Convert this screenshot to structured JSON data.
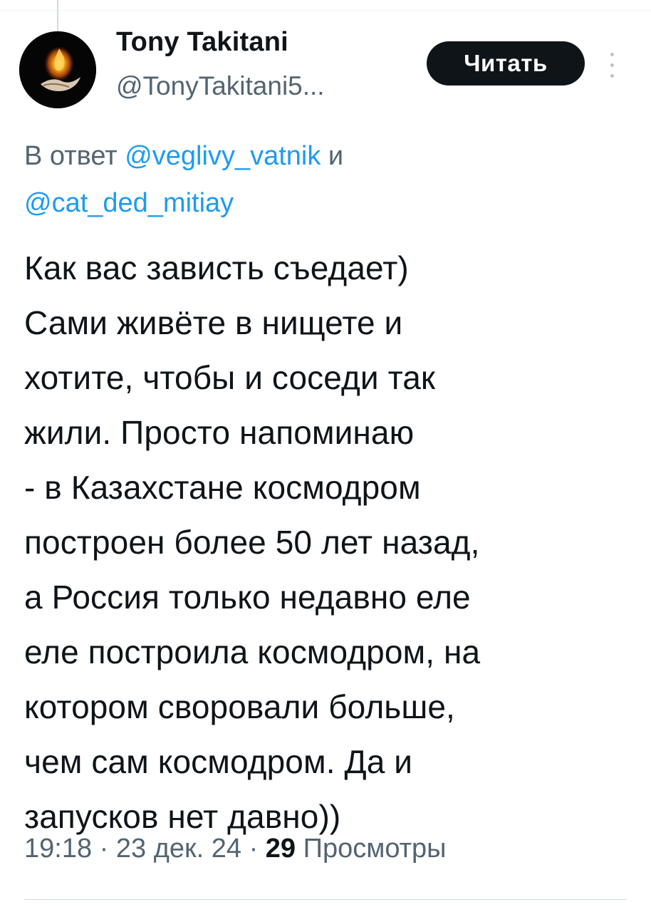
{
  "author": {
    "display_name": "Tony Takitani",
    "handle": "@TonyTakitani5...",
    "avatar_icon": "avatar-flame-icon"
  },
  "follow_button": {
    "label": "Читать"
  },
  "more_menu": {
    "icon": "more-vertical-icon"
  },
  "reply_context": {
    "prefix": "В ответ",
    "mention_1": "@veglivy_vatnik",
    "conjunction": "и",
    "mention_2": "@cat_ded_mitiay"
  },
  "tweet": {
    "text": "Как вас зависть съедает)\nСами живёте в нищете и\nхотите, чтобы и соседи так\nжили. Просто напоминаю\n- в Казахстане космодром\nпостроен более 50 лет назад,\nа Россия только недавно еле\nеле построила космодром, на\nкотором своровали больше,\nчем сам космодром. Да и\nзапусков нет давно))"
  },
  "meta": {
    "time": "19:18",
    "separator": "·",
    "date": "23 дек. 24",
    "views_count": "29",
    "views_label": "Просмотры"
  },
  "colors": {
    "text_primary": "#0f1419",
    "text_secondary": "#536471",
    "link": "#1d9bf0",
    "button_bg": "#0f1419",
    "divider": "#cfd9de"
  }
}
